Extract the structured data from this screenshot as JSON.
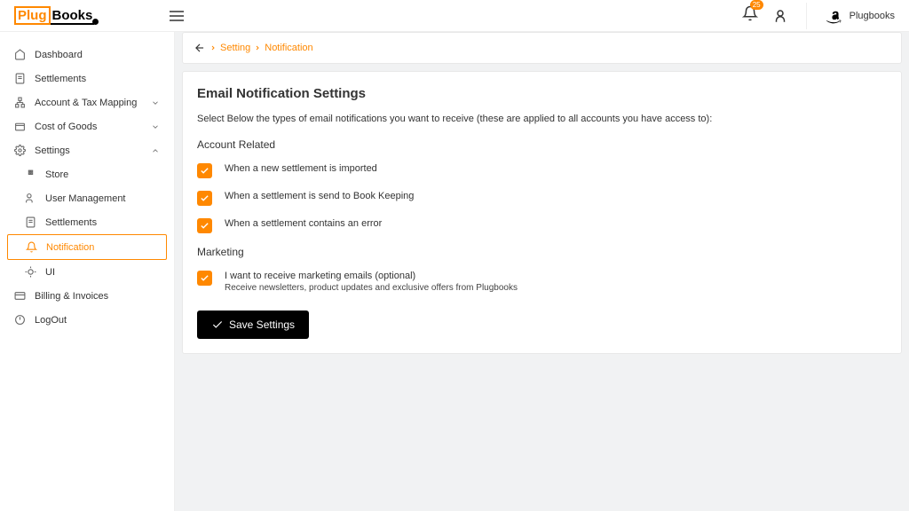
{
  "header": {
    "logo_plug": "Plug",
    "logo_books": "Books",
    "badge_count": "25",
    "brand_label": "Plugbooks"
  },
  "sidebar": {
    "items": [
      {
        "label": "Dashboard"
      },
      {
        "label": "Settlements"
      },
      {
        "label": "Account & Tax Mapping"
      },
      {
        "label": "Cost of Goods"
      },
      {
        "label": "Settings"
      },
      {
        "label": "Store"
      },
      {
        "label": "User Management"
      },
      {
        "label": "Settlements"
      },
      {
        "label": "Notification"
      },
      {
        "label": "UI"
      },
      {
        "label": "Billing & Invoices"
      },
      {
        "label": "LogOut"
      }
    ]
  },
  "breadcrumb": {
    "item1": "Setting",
    "item2": "Notification"
  },
  "content": {
    "title": "Email Notification Settings",
    "description": "Select Below the types of email notifications you want to receive (these are applied to all accounts you have access to):",
    "section1": "Account Related",
    "check1": "When a new settlement is imported",
    "check2": "When a settlement is send to Book Keeping",
    "check3": "When a settlement contains an error",
    "section2": "Marketing",
    "check4": "I want to receive marketing emails (optional)",
    "check4_sub": "Receive newsletters, product updates and exclusive offers from Plugbooks",
    "save_label": "Save Settings"
  }
}
